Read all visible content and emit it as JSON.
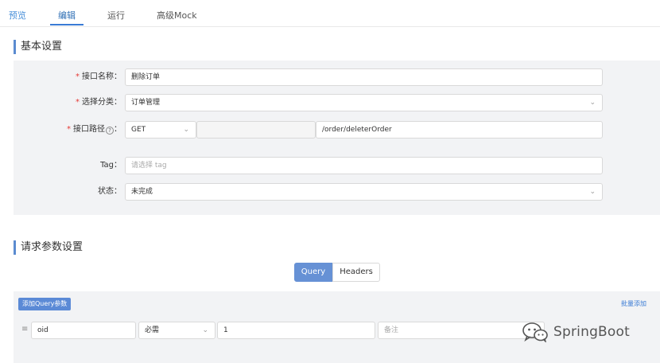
{
  "tabs": {
    "preview": "预览",
    "edit": "编辑",
    "run": "运行",
    "mock": "高级Mock"
  },
  "basic": {
    "title": "基本设置",
    "name_label": "接口名称：",
    "name_value": "删除订单",
    "category_label": "选择分类：",
    "category_value": "订单管理",
    "path_label": "接口路径",
    "path_label_suffix": "：",
    "method_value": "GET",
    "path_prefix": "",
    "path_value": "/order/deleterOrder",
    "tag_label": "Tag：",
    "tag_placeholder": "请选择 tag",
    "status_label": "状态：",
    "status_value": "未完成"
  },
  "request": {
    "title": "请求参数设置",
    "tab_query": "Query",
    "tab_headers": "Headers",
    "add_query_button": "添加Query参数",
    "bulk_add": "批量添加",
    "params": [
      {
        "name": "oid",
        "required": "必需",
        "example": "1",
        "remark_placeholder": "备注"
      }
    ]
  },
  "watermark": "SpringBoot",
  "colors": {
    "accent": "#6691d5",
    "required_star": "#e53935",
    "panel_bg": "#f2f3f5"
  }
}
